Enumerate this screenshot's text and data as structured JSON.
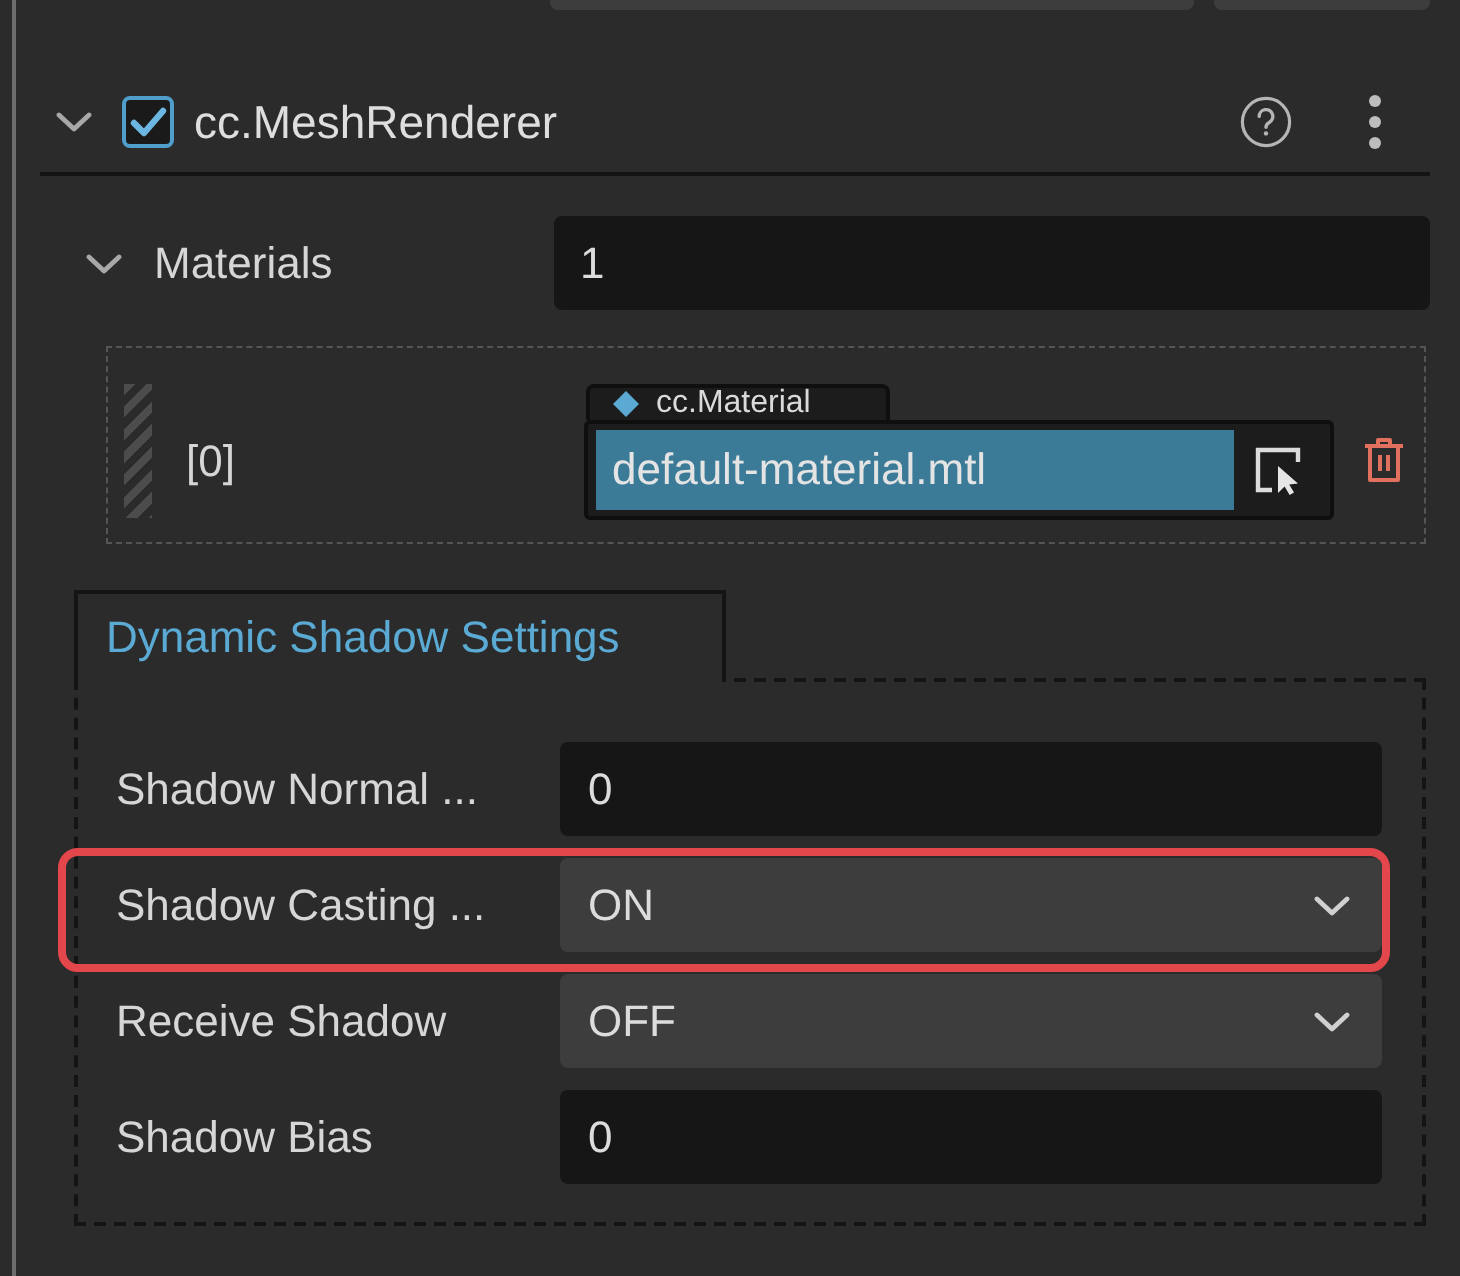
{
  "component": {
    "title": "cc.MeshRenderer",
    "enabled": true,
    "expanded": true
  },
  "materials": {
    "label": "Materials",
    "expanded": true,
    "count": "1",
    "items": [
      {
        "index": "[0]",
        "asset_type": "cc.Material",
        "value": "default-material.mtl"
      }
    ]
  },
  "shadow_settings": {
    "tab": {
      "label": "Dynamic Shadow Settings",
      "selected": true
    },
    "properties": [
      {
        "kind": "number",
        "label": "Shadow Normal ...",
        "value": "0",
        "highlighted": false
      },
      {
        "kind": "select",
        "label": "Shadow Casting ...",
        "value": "ON",
        "highlighted": true
      },
      {
        "kind": "select",
        "label": "Receive Shadow",
        "value": "OFF",
        "highlighted": false
      },
      {
        "kind": "number",
        "label": "Shadow Bias",
        "value": "0",
        "highlighted": false
      }
    ]
  }
}
